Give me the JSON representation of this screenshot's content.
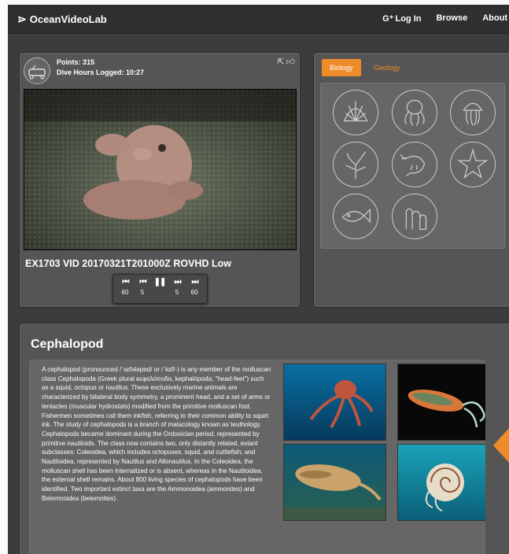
{
  "header": {
    "logo_text": "OceanVideoLab",
    "nav": [
      {
        "label": "Log In",
        "icon": "google-plus-icon"
      },
      {
        "label": "Browse"
      },
      {
        "label": "About"
      }
    ]
  },
  "video_panel": {
    "points": "Points: 315",
    "dive_hours": "Dive Hours Logged: 10:27",
    "video_title": "EX1703 VID 20170321T201000Z ROVHD Low",
    "controls": [
      {
        "symbol": "⏮",
        "label": "60",
        "icon": "skip-back-60-icon"
      },
      {
        "symbol": "⏮",
        "label": "5",
        "icon": "skip-back-5-icon"
      },
      {
        "symbol": "❚❚",
        "label": "",
        "icon": "pause-icon"
      },
      {
        "symbol": "⏭",
        "label": "5",
        "icon": "skip-forward-5-icon"
      },
      {
        "symbol": "⏭",
        "label": "60",
        "icon": "skip-forward-60-icon"
      }
    ]
  },
  "category_panel": {
    "tabs": [
      {
        "label": "Biology",
        "active": true
      },
      {
        "label": "Geology",
        "active": false
      }
    ],
    "icons": [
      "scallop-icon",
      "octopus-icon",
      "jellyfish-icon",
      "coral-icon",
      "shrimp-icon",
      "starfish-icon",
      "fish-icon",
      "sponge-icon"
    ]
  },
  "info_panel": {
    "title": "Cephalopod",
    "paragraph1": "A cephalopod (pronounced /ˈsɛfələpɒd/ or /ˈkɛf/-) is any member of the molluscan class Cephalopoda (Greek plural κεφαλόποδα, kephalópoda; \"head-feet\") such as a squid, octopus or nautilus. These exclusively marine animals are characterized by bilateral body symmetry, a prominent head, and a set of arms or tentacles (muscular hydrostats) modified from the primitive molluscan foot. Fishermen sometimes call them inkfish, referring to their common ability to squirt ink. The study of cephalopods is a branch of malacology known as teuthology.",
    "paragraph2": "Cephalopods became dominant during the Ordovician period, represented by primitive nautiloids. The class now contains two, only distantly related, extant subclasses: Coleoidea, which includes octopuses, squid, and cuttlefish; and Nautiloidea, represented by Nautilus and Allonautilus. In the Coleoidea, the molluscan shell has been internalized or is absent, whereas in the Nautiloidea, the external shell remains. About 800 living species of cephalopods have been identified. Two important extinct taxa are the Ammonoidea (ammonites) and Belemnoidea (belemnites).",
    "photos": [
      "octopus-photo",
      "squid-photo",
      "cuttlefish-photo",
      "nautilus-photo"
    ]
  },
  "colors": {
    "accent": "#ef8c2a",
    "panel": "#555555",
    "background": "#3c3c3c"
  }
}
